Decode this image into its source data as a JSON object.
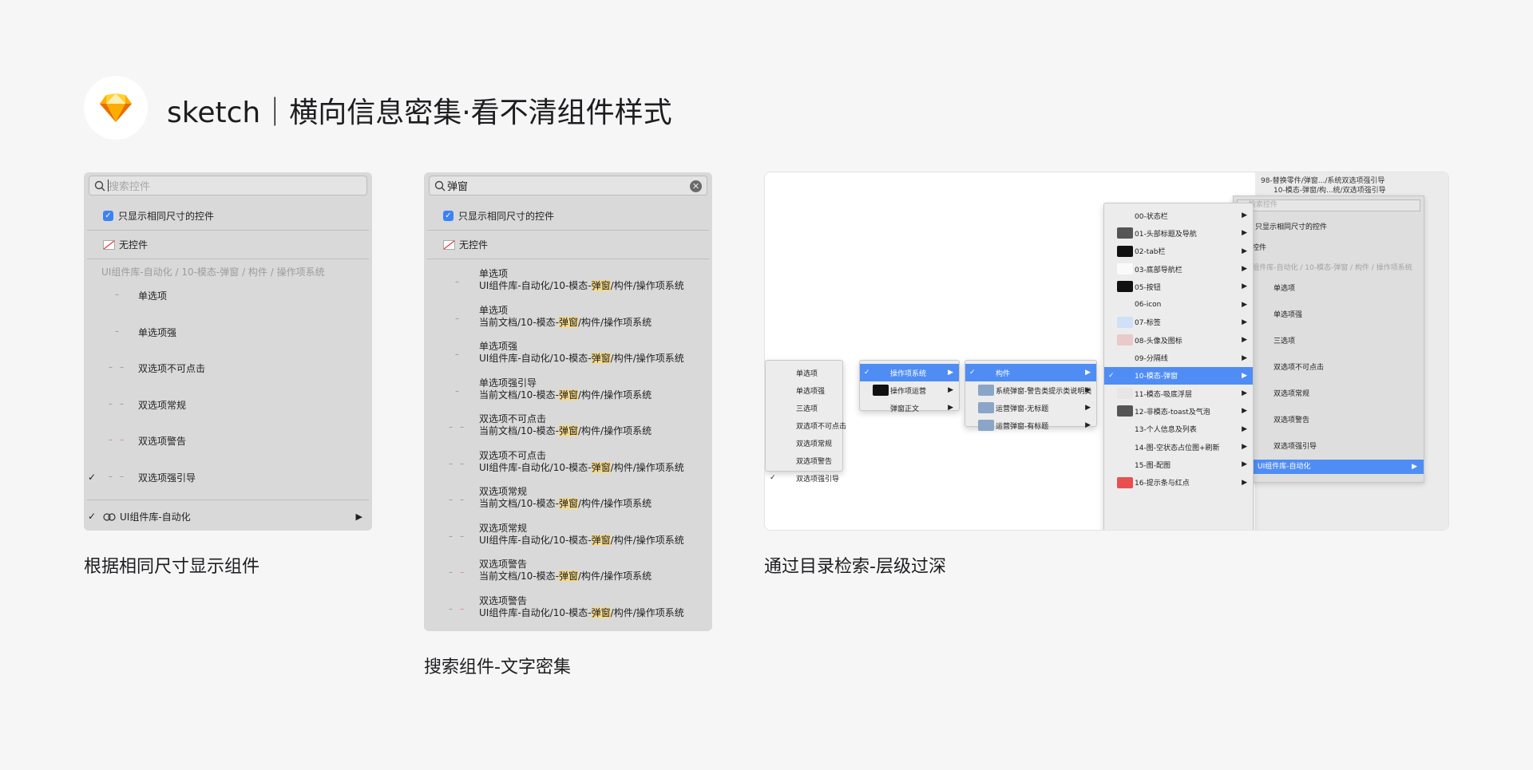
{
  "header": {
    "title": "sketch｜横向信息密集·看不清组件样式"
  },
  "colors": {
    "accent": "#3b82f6",
    "selected": "#4f8df5",
    "highlight": "#f5d98c",
    "logo_yellow": "#f5a623"
  },
  "panel1": {
    "search_placeholder": "搜索控件",
    "only_same_size": "只显示相同尺寸的控件",
    "no_component": "无控件",
    "group_path": "UI组件库-自动化 / 10-模态-弹窗 / 构件 / 操作项系统",
    "items": [
      "单选项",
      "单选项强",
      "双选项不可点击",
      "双选项常规",
      "双选项警告",
      "双选项强引导"
    ],
    "footer": "UI组件库-自动化",
    "caption": "根据相同尺寸显示组件"
  },
  "panel2": {
    "search_value": "弹窗",
    "only_same_size": "只显示相同尺寸的控件",
    "no_component": "无控件",
    "results": [
      {
        "name": "单选项",
        "pre": "UI组件库-自动化/10-模态-",
        "hl": "弹窗",
        "post": "/构件/操作项系统"
      },
      {
        "name": "单选项",
        "pre": "当前文档/10-模态-",
        "hl": "弹窗",
        "post": "/构件/操作项系统"
      },
      {
        "name": "单选项强",
        "pre": "UI组件库-自动化/10-模态-",
        "hl": "弹窗",
        "post": "/构件/操作项系统"
      },
      {
        "name": "单选项强引导",
        "pre": "当前文档/10-模态-",
        "hl": "弹窗",
        "post": "/构件/操作项系统"
      },
      {
        "name": "双选项不可点击",
        "pre": "当前文档/10-模态-",
        "hl": "弹窗",
        "post": "/构件/操作项系统"
      },
      {
        "name": "双选项不可点击",
        "pre": "UI组件库-自动化/10-模态-",
        "hl": "弹窗",
        "post": "/构件/操作项系统"
      },
      {
        "name": "双选项常规",
        "pre": "当前文档/10-模态-",
        "hl": "弹窗",
        "post": "/构件/操作项系统"
      },
      {
        "name": "双选项常规",
        "pre": "UI组件库-自动化/10-模态-",
        "hl": "弹窗",
        "post": "/构件/操作项系统"
      },
      {
        "name": "双选项警告",
        "pre": "当前文档/10-模态-",
        "hl": "弹窗",
        "post": "/构件/操作项系统"
      },
      {
        "name": "双选项警告",
        "pre": "UI组件库-自动化/10-模态-",
        "hl": "弹窗",
        "post": "/构件/操作项系统"
      }
    ],
    "caption": "搜索组件-文字密集"
  },
  "panel3": {
    "top_label": "98-替换零件/弹窗.../系统双选项强引导",
    "top_select": "10-模态-弹窗/构...统/双选项强引导",
    "m1": [
      "单选项",
      "单选项强",
      "三选项",
      "双选项不可点击",
      "双选项常规",
      "双选项警告",
      "双选项强引导"
    ],
    "m2": [
      "操作项系统",
      "操作项运营",
      "弹窗正文"
    ],
    "m3": [
      "构件",
      "系统弹窗-警告类提示类说明类",
      "运营弹窗-无标题",
      "运营弹窗-有标题"
    ],
    "m4": [
      "00-状态栏",
      "01-头部标题及导航",
      "02-tab栏",
      "03-底部导航栏",
      "05-按钮",
      "06-icon",
      "07-标签",
      "08-头像及图标",
      "09-分隔线",
      "10-模态-弹窗",
      "11-模态-吸底浮层",
      "12-非模态-toast及气泡",
      "13-个人信息及列表",
      "14-图-空状态占位图+刷新",
      "15-图-配图",
      "16-提示条与红点"
    ],
    "mini": {
      "search_placeholder": "搜索控件",
      "only_same_size": "只显示相同尺寸的控件",
      "no_component": "无控件",
      "group_path": "UI组件库-自动化 / 10-模态-弹窗 / 构件 / 操作项系统",
      "items": [
        "单选项",
        "单选项强",
        "三选项",
        "双选项不可点击",
        "双选项常规",
        "双选项警告",
        "双选项强引导"
      ],
      "footer": "UI组件库-自动化"
    },
    "caption": "通过目录检索-层级过深"
  }
}
